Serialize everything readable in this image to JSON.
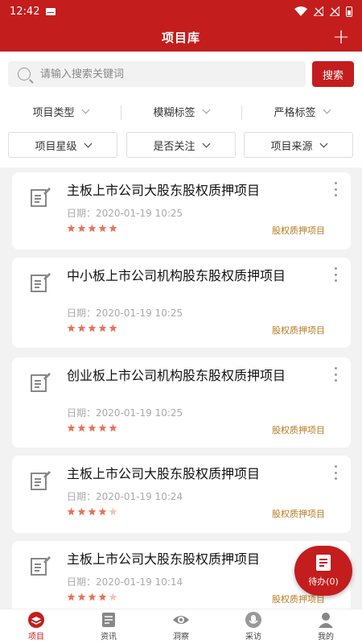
{
  "status_bar": {
    "time": "12:42"
  },
  "header": {
    "title": "项目库",
    "add_label": "+"
  },
  "search": {
    "placeholder": "请输入搜索关键词",
    "button_label": "搜索"
  },
  "filters_row1": [
    "项目类型",
    "模糊标签",
    "严格标签"
  ],
  "filters_row2": [
    "项目星级",
    "是否关注",
    "项目来源"
  ],
  "cards": [
    {
      "title": "主板上市公司大股东股权质押项目",
      "date": "日期：2020-01-19 10:25",
      "stars": 5,
      "tag": "股权质押项目"
    },
    {
      "title": "中小板上市公司机构股东股权质押项目",
      "date": "日期：2020-01-19 10:25",
      "stars": 5,
      "tag": "股权质押项目"
    },
    {
      "title": "创业板上市公司机构股东股权质押项目",
      "date": "日期：2020-01-19 10:25",
      "stars": 5,
      "tag": "股权质押项目"
    },
    {
      "title": "主板上市公司大股东股权质押项目",
      "date": "日期：2020-01-19 10:24",
      "stars": 4,
      "tag": "股权质押项目"
    },
    {
      "title": "主板上市公司大股东股权质押项目",
      "date": "日期：2020-01-19 10:14",
      "stars": 4,
      "tag": "股权质押项目"
    }
  ],
  "fab": {
    "label": "待办(0)"
  },
  "tabs": [
    {
      "label": "项目",
      "icon": "layers-icon",
      "active": true
    },
    {
      "label": "资讯",
      "icon": "news-icon",
      "active": false
    },
    {
      "label": "洞察",
      "icon": "eye-icon",
      "active": false
    },
    {
      "label": "采访",
      "icon": "microphone-icon",
      "active": false
    },
    {
      "label": "我的",
      "icon": "user-icon",
      "active": false
    }
  ],
  "colors": {
    "brand": "#c41d1d",
    "star_on": "#e8735a",
    "star_off": "#f5c3b6",
    "tag": "#b7791f"
  }
}
